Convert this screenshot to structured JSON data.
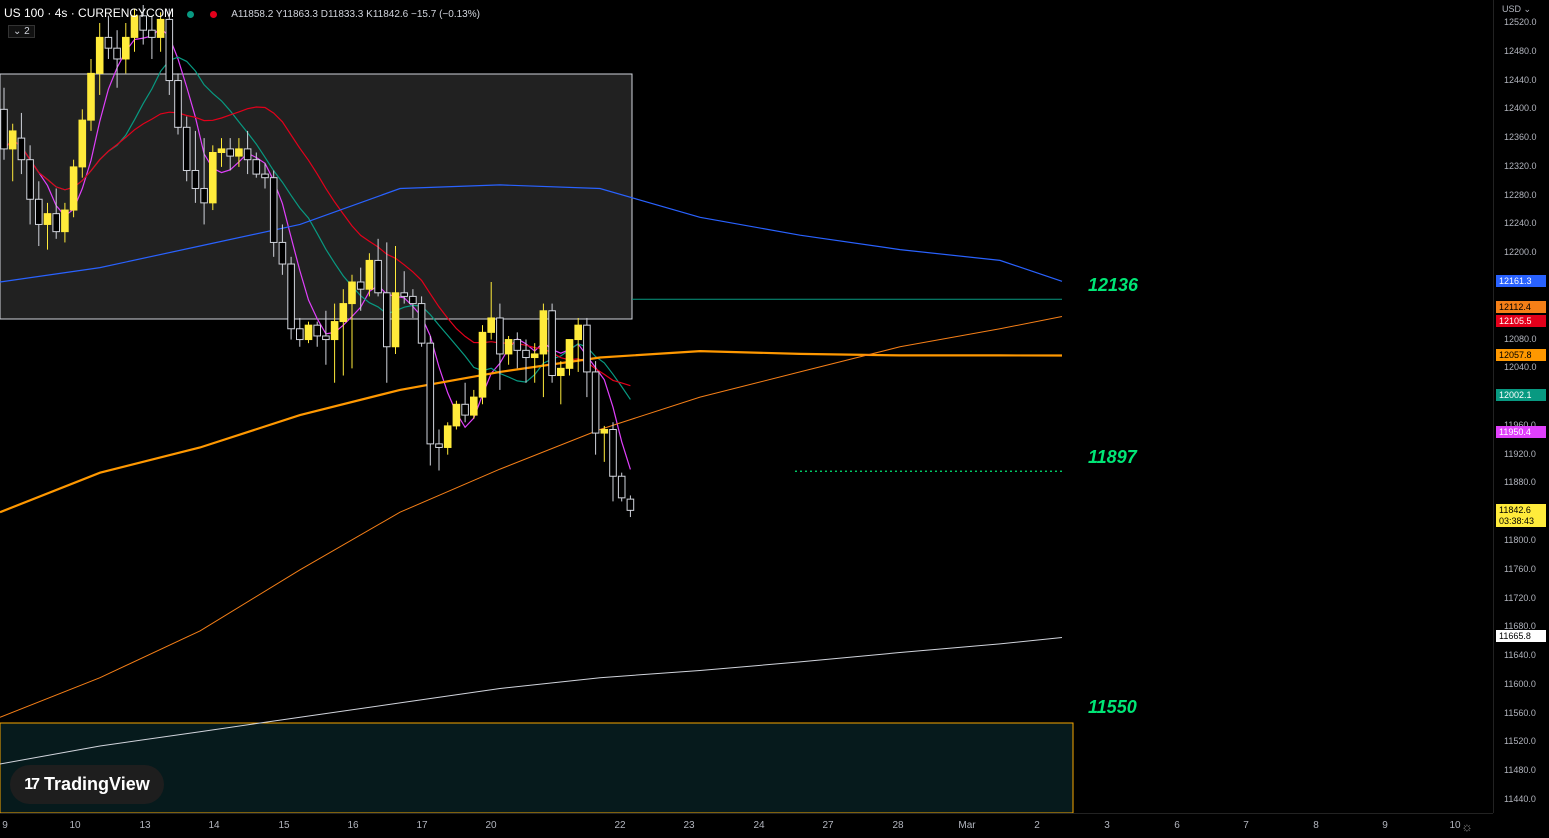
{
  "header": {
    "symbol": "US 100 · 4s · CURRENCYCOM",
    "ohlc": "A11858.2 Y11863.3 D11833.3 K11842.6 −15.7 (−0.13%)",
    "collapse_label": "⌄ 2"
  },
  "price_axis": {
    "currency": "USD ⌄",
    "ticks": [
      "12520.0",
      "12480.0",
      "12440.0",
      "12400.0",
      "12360.0",
      "12320.0",
      "12280.0",
      "12240.0",
      "12200.0",
      "12080.0",
      "12040.0",
      "11960.0",
      "11920.0",
      "11880.0",
      "11800.0",
      "11760.0",
      "11720.0",
      "11680.0",
      "11640.0",
      "11600.0",
      "11560.0",
      "11520.0",
      "11480.0",
      "11440.0"
    ],
    "badges": [
      {
        "value": "12161.3",
        "bg": "#2962ff",
        "fg": "#ffffff"
      },
      {
        "value": "12112.4",
        "bg": "#f57f17",
        "fg": "#000000"
      },
      {
        "value": "12105.5",
        "bg": "#e3001b",
        "fg": "#ffffff"
      },
      {
        "value": "12057.8",
        "bg": "#ff9800",
        "fg": "#000000"
      },
      {
        "value": "12002.1",
        "bg": "#089981",
        "fg": "#ffffff"
      },
      {
        "value": "11950.4",
        "bg": "#e040fb",
        "fg": "#ffffff"
      },
      {
        "value": "11842.6",
        "bg": "#ffeb3b",
        "fg": "#000000"
      },
      {
        "value": "03:38:43",
        "bg": "#ffeb3b",
        "fg": "#000000"
      },
      {
        "value": "11665.8",
        "bg": "#ffffff",
        "fg": "#000000"
      }
    ]
  },
  "time_axis": {
    "ticks": [
      "9",
      "10",
      "13",
      "14",
      "15",
      "16",
      "17",
      "20",
      "22",
      "23",
      "24",
      "27",
      "28",
      "Mar",
      "2",
      "3",
      "6",
      "7",
      "8",
      "9",
      "10"
    ]
  },
  "levels": [
    {
      "label": "12136",
      "price": 12136
    },
    {
      "label": "11897",
      "price": 11897
    },
    {
      "label": "11550",
      "price": 11550
    }
  ],
  "logo": {
    "text": "TradingView",
    "mark": "17"
  },
  "colors": {
    "bull": "#ffeb3b",
    "bear": "#000000",
    "wick": "#ffeb3b",
    "ma_magenta": "#e040fb",
    "ma_teal": "#089981",
    "ma_red": "#e3001b",
    "ma_blue": "#2962ff",
    "ma_orange": "#ff9800",
    "ma_orange_thin": "#f57f17",
    "ma_white": "#d1d4dc",
    "level_green": "#00e676"
  },
  "chart_data": {
    "type": "candlestick",
    "symbol": "US 100",
    "timeframe": "4h",
    "price_range": [
      11420,
      12540
    ],
    "candles": [
      {
        "o": 12400,
        "h": 12430,
        "l": 12330,
        "c": 12345
      },
      {
        "o": 12345,
        "h": 12380,
        "l": 12300,
        "c": 12370
      },
      {
        "o": 12360,
        "h": 12395,
        "l": 12310,
        "c": 12330
      },
      {
        "o": 12330,
        "h": 12350,
        "l": 12240,
        "c": 12275
      },
      {
        "o": 12275,
        "h": 12300,
        "l": 12210,
        "c": 12240
      },
      {
        "o": 12240,
        "h": 12270,
        "l": 12205,
        "c": 12255
      },
      {
        "o": 12255,
        "h": 12290,
        "l": 12220,
        "c": 12230
      },
      {
        "o": 12230,
        "h": 12270,
        "l": 12215,
        "c": 12260
      },
      {
        "o": 12260,
        "h": 12330,
        "l": 12250,
        "c": 12320
      },
      {
        "o": 12320,
        "h": 12400,
        "l": 12305,
        "c": 12385
      },
      {
        "o": 12385,
        "h": 12470,
        "l": 12370,
        "c": 12450
      },
      {
        "o": 12450,
        "h": 12520,
        "l": 12420,
        "c": 12500
      },
      {
        "o": 12500,
        "h": 12530,
        "l": 12470,
        "c": 12485
      },
      {
        "o": 12485,
        "h": 12510,
        "l": 12430,
        "c": 12470
      },
      {
        "o": 12470,
        "h": 12520,
        "l": 12450,
        "c": 12500
      },
      {
        "o": 12500,
        "h": 12540,
        "l": 12480,
        "c": 12530
      },
      {
        "o": 12530,
        "h": 12545,
        "l": 12490,
        "c": 12510
      },
      {
        "o": 12510,
        "h": 12530,
        "l": 12470,
        "c": 12500
      },
      {
        "o": 12500,
        "h": 12535,
        "l": 12480,
        "c": 12525
      },
      {
        "o": 12525,
        "h": 12540,
        "l": 12420,
        "c": 12440
      },
      {
        "o": 12440,
        "h": 12450,
        "l": 12365,
        "c": 12375
      },
      {
        "o": 12375,
        "h": 12390,
        "l": 12300,
        "c": 12315
      },
      {
        "o": 12315,
        "h": 12370,
        "l": 12270,
        "c": 12290
      },
      {
        "o": 12290,
        "h": 12360,
        "l": 12240,
        "c": 12270
      },
      {
        "o": 12270,
        "h": 12350,
        "l": 12260,
        "c": 12340
      },
      {
        "o": 12340,
        "h": 12360,
        "l": 12320,
        "c": 12345
      },
      {
        "o": 12345,
        "h": 12360,
        "l": 12315,
        "c": 12335
      },
      {
        "o": 12335,
        "h": 12360,
        "l": 12320,
        "c": 12345
      },
      {
        "o": 12345,
        "h": 12370,
        "l": 12310,
        "c": 12330
      },
      {
        "o": 12330,
        "h": 12340,
        "l": 12305,
        "c": 12310
      },
      {
        "o": 12310,
        "h": 12325,
        "l": 12290,
        "c": 12305
      },
      {
        "o": 12305,
        "h": 12315,
        "l": 12195,
        "c": 12215
      },
      {
        "o": 12215,
        "h": 12240,
        "l": 12170,
        "c": 12185
      },
      {
        "o": 12185,
        "h": 12195,
        "l": 12080,
        "c": 12095
      },
      {
        "o": 12095,
        "h": 12110,
        "l": 12070,
        "c": 12080
      },
      {
        "o": 12080,
        "h": 12105,
        "l": 12075,
        "c": 12100
      },
      {
        "o": 12100,
        "h": 12105,
        "l": 12070,
        "c": 12085
      },
      {
        "o": 12085,
        "h": 12120,
        "l": 12045,
        "c": 12080
      },
      {
        "o": 12080,
        "h": 12130,
        "l": 12020,
        "c": 12105
      },
      {
        "o": 12105,
        "h": 12150,
        "l": 12030,
        "c": 12130
      },
      {
        "o": 12130,
        "h": 12170,
        "l": 12040,
        "c": 12160
      },
      {
        "o": 12160,
        "h": 12180,
        "l": 12120,
        "c": 12150
      },
      {
        "o": 12150,
        "h": 12200,
        "l": 12140,
        "c": 12190
      },
      {
        "o": 12190,
        "h": 12220,
        "l": 12140,
        "c": 12145
      },
      {
        "o": 12145,
        "h": 12215,
        "l": 12020,
        "c": 12070
      },
      {
        "o": 12070,
        "h": 12210,
        "l": 12060,
        "c": 12145
      },
      {
        "o": 12145,
        "h": 12175,
        "l": 12130,
        "c": 12140
      },
      {
        "o": 12140,
        "h": 12150,
        "l": 12110,
        "c": 12130
      },
      {
        "o": 12130,
        "h": 12140,
        "l": 12070,
        "c": 12075
      },
      {
        "o": 12075,
        "h": 12085,
        "l": 11905,
        "c": 11935
      },
      {
        "o": 11935,
        "h": 11955,
        "l": 11898,
        "c": 11930
      },
      {
        "o": 11930,
        "h": 11965,
        "l": 11920,
        "c": 11960
      },
      {
        "o": 11960,
        "h": 11995,
        "l": 11955,
        "c": 11990
      },
      {
        "o": 11990,
        "h": 12020,
        "l": 11965,
        "c": 11975
      },
      {
        "o": 11975,
        "h": 12010,
        "l": 11970,
        "c": 12000
      },
      {
        "o": 12000,
        "h": 12100,
        "l": 11990,
        "c": 12090
      },
      {
        "o": 12090,
        "h": 12160,
        "l": 12080,
        "c": 12110
      },
      {
        "o": 12110,
        "h": 12130,
        "l": 12010,
        "c": 12060
      },
      {
        "o": 12060,
        "h": 12085,
        "l": 12045,
        "c": 12080
      },
      {
        "o": 12080,
        "h": 12090,
        "l": 12040,
        "c": 12065
      },
      {
        "o": 12065,
        "h": 12080,
        "l": 12020,
        "c": 12055
      },
      {
        "o": 12055,
        "h": 12075,
        "l": 12020,
        "c": 12060
      },
      {
        "o": 12060,
        "h": 12130,
        "l": 12000,
        "c": 12120
      },
      {
        "o": 12120,
        "h": 12130,
        "l": 12020,
        "c": 12030
      },
      {
        "o": 12030,
        "h": 12050,
        "l": 11990,
        "c": 12040
      },
      {
        "o": 12040,
        "h": 12080,
        "l": 12030,
        "c": 12080
      },
      {
        "o": 12080,
        "h": 12110,
        "l": 12035,
        "c": 12100
      },
      {
        "o": 12100,
        "h": 12110,
        "l": 12000,
        "c": 12035
      },
      {
        "o": 12035,
        "h": 12050,
        "l": 11920,
        "c": 11950
      },
      {
        "o": 11950,
        "h": 11960,
        "l": 11910,
        "c": 11955
      },
      {
        "o": 11955,
        "h": 11965,
        "l": 11855,
        "c": 11890
      },
      {
        "o": 11890,
        "h": 11895,
        "l": 11855,
        "c": 11860
      },
      {
        "o": 11858.2,
        "h": 11863.3,
        "l": 11833.3,
        "c": 11842.6
      }
    ]
  }
}
